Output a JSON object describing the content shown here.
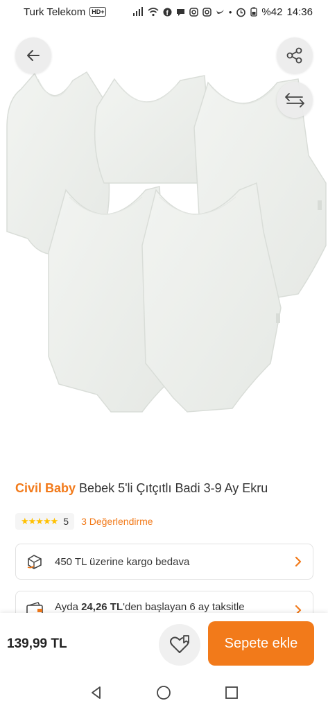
{
  "status_bar": {
    "carrier": "Turk Telekom",
    "network_badge": "HD+",
    "battery": "%42",
    "time": "14:36",
    "icons": [
      "signal-icon",
      "wifi-icon",
      "facebook-icon",
      "message-icon",
      "instagram-icon",
      "instagram-icon",
      "bird-icon",
      "dot-icon",
      "alarm-icon",
      "battery-icon"
    ]
  },
  "hero": {
    "icons": [
      "back-arrow-icon",
      "share-icon",
      "compare-arrows-icon"
    ]
  },
  "product": {
    "brand": "Civil Baby",
    "name": "Bebek 5'li Çıtçıtlı Badi 3-9 Ay  Ekru",
    "rating": "5",
    "stars": "★★★★★",
    "reviews": "3 Değerlendirme"
  },
  "cards": {
    "shipping": {
      "text": "450 TL üzerine kargo bedava",
      "icon": "cargo-icon"
    },
    "installment": {
      "prefix": "Ayda ",
      "amount": "24,26 TL",
      "suffix": "'den başlayan  6 ay taksitle",
      "icon": "wallet-icon"
    }
  },
  "action_bar": {
    "price": "139,99 TL",
    "cart_label": "Sepete ekle",
    "fav_icon": "heart-bookmark-icon"
  },
  "nav_bar": {
    "icons": [
      "back-triangle-icon",
      "home-circle-icon",
      "recents-square-icon"
    ]
  },
  "colors": {
    "accent": "#f27a1a",
    "star": "#ffc000"
  }
}
